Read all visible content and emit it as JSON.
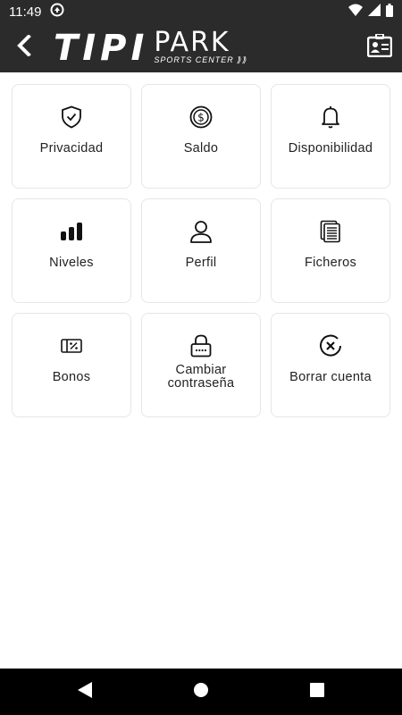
{
  "status_bar": {
    "time": "11:49",
    "icons": [
      "notification-icon",
      "wifi-icon",
      "signal-icon",
      "battery-icon"
    ]
  },
  "app_bar": {
    "logo": {
      "word1": "TIPI",
      "word2": "PARK",
      "subtitle": "SPORTS CENTER ⟫⟫"
    },
    "back_icon": "chevron-left-icon",
    "right_icon": "id-card-icon"
  },
  "menu": {
    "items": [
      {
        "label": "Privacidad",
        "icon": "shield-check-icon"
      },
      {
        "label": "Saldo",
        "icon": "dollar-coin-icon"
      },
      {
        "label": "Disponibilidad",
        "icon": "bell-icon"
      },
      {
        "label": "Niveles",
        "icon": "bar-chart-icon"
      },
      {
        "label": "Perfil",
        "icon": "user-icon"
      },
      {
        "label": "Ficheros",
        "icon": "documents-icon"
      },
      {
        "label": "Bonos",
        "icon": "ticket-percent-icon"
      },
      {
        "label": "Cambiar contraseña",
        "icon": "lock-icon"
      },
      {
        "label": "Borrar cuenta",
        "icon": "delete-circle-icon"
      }
    ]
  },
  "nav_bar": {
    "icons": [
      "back-triangle-icon",
      "home-circle-icon",
      "recents-square-icon"
    ]
  }
}
